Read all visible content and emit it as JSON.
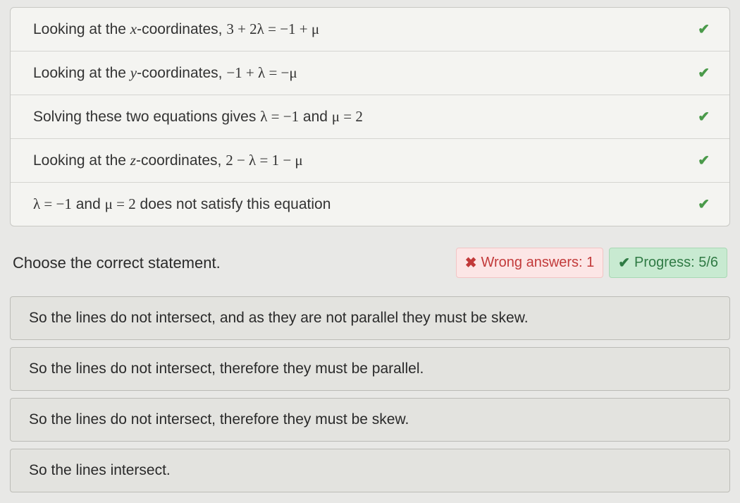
{
  "steps": [
    {
      "prefix": "Looking at the ",
      "var": "x",
      "mid": "-coordinates, ",
      "eq": "3 + 2λ = −1 + μ",
      "correct": true
    },
    {
      "prefix": "Looking at the ",
      "var": "y",
      "mid": "-coordinates, ",
      "eq": "−1 + λ = −μ",
      "correct": true
    },
    {
      "prefix": "Solving these two equations gives ",
      "eq": "λ = −1",
      "mid2": " and ",
      "eq2": "μ = 2",
      "correct": true
    },
    {
      "prefix": "Looking at the ",
      "var": "z",
      "mid": "-coordinates, ",
      "eq": "2 − λ = 1 − μ",
      "correct": true
    },
    {
      "eq": "λ = −1",
      "mid2": " and ",
      "eq2": "μ = 2",
      "suffix": " does not satisfy this equation",
      "correct": true
    }
  ],
  "prompt": "Choose the correct statement.",
  "wrong": {
    "icon": "✖",
    "label": "Wrong answers: 1"
  },
  "progress": {
    "icon": "✔",
    "label": "Progress: 5/6"
  },
  "options": [
    "So the lines do not intersect, and as they are not parallel they must be skew.",
    "So the lines do not intersect, therefore they must be parallel.",
    "So the lines do not intersect, therefore they must be skew.",
    "So the lines intersect."
  ],
  "checkmark": "✔"
}
